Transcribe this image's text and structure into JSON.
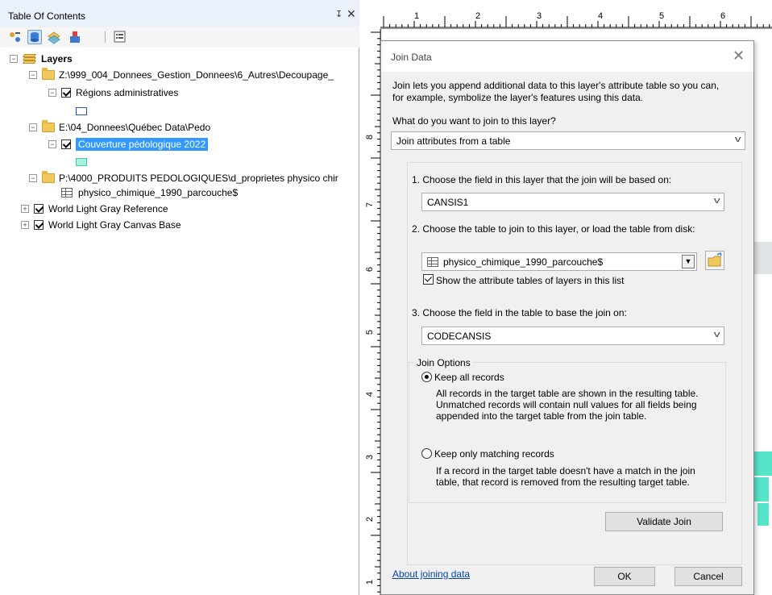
{
  "toc": {
    "title": "Table Of Contents",
    "pin_glyph": "↧",
    "close_glyph": "✕",
    "toolbar_icons": [
      "list-by-drawing-order-icon",
      "list-by-source-icon",
      "list-by-visibility-icon",
      "list-by-selection-icon",
      "options-icon"
    ],
    "tree": {
      "root_label": "Layers",
      "groups": [
        {
          "path": "Z:\\999_004_Donnees_Gestion_Donnees\\6_Autres\\Decoupage_",
          "layers": [
            {
              "label": "Régions administratives",
              "swatch_fill": "#ffffff",
              "swatch_border": "#2a55c5"
            }
          ]
        },
        {
          "path": "E:\\04_Donnees\\Québec Data\\Pedo",
          "layers": [
            {
              "label": "Couverture pédologique 2022",
              "swatch_fill": "#a8f0e0",
              "swatch_border": "#4cc8a8"
            }
          ]
        },
        {
          "path": "P:\\4000_PRODUITS PEDOLOGIQUES\\d_proprietes physico chir",
          "tables": [
            {
              "label": "physico_chimique_1990_parcouche$"
            }
          ]
        }
      ],
      "basemaps": [
        {
          "label": "World Light Gray Reference"
        },
        {
          "label": "World Light Gray Canvas Base"
        }
      ]
    }
  },
  "layout": {
    "ruler_top_numbers": [
      "1",
      "2",
      "3",
      "4",
      "5",
      "6"
    ],
    "ruler_left_numbers": [
      "8",
      "7",
      "6",
      "5",
      "4",
      "3",
      "2",
      "1"
    ]
  },
  "dialog": {
    "title": "Join Data",
    "intro_line1": "Join lets you append additional data to this layer's attribute table so you can,",
    "intro_line2": "for example, symbolize the layer's features using this data.",
    "question": "What do you want to join to this layer?",
    "join_type": "Join attributes from a table",
    "step1_label": "1.  Choose the field in this layer that the join will be based on:",
    "step1_value": "CANSIS1",
    "step2_label": "2.  Choose the table to join to this layer, or load the table from disk:",
    "step2_value": "physico_chimique_1990_parcouche$",
    "show_attr_tables_label": "Show the attribute tables of layers in this list",
    "step3_label": "3.  Choose the field in the table to base the join on:",
    "step3_value": "CODECANSIS",
    "join_options_title": "Join Options",
    "keep_all_label": "Keep all records",
    "keep_all_desc1": "All records in the target table are shown in the resulting table.",
    "keep_all_desc2": "Unmatched records will contain null values for all fields being",
    "keep_all_desc3": "appended into the target table from the join table.",
    "keep_matching_label": "Keep only matching records",
    "keep_matching_desc1": "If a record in the target table doesn't have a match in the join",
    "keep_matching_desc2": "table, that record is removed from the resulting target table.",
    "validate_label": "Validate Join",
    "about_link": "About joining data",
    "ok_label": "OK",
    "cancel_label": "Cancel",
    "close_glyph": "✕"
  }
}
